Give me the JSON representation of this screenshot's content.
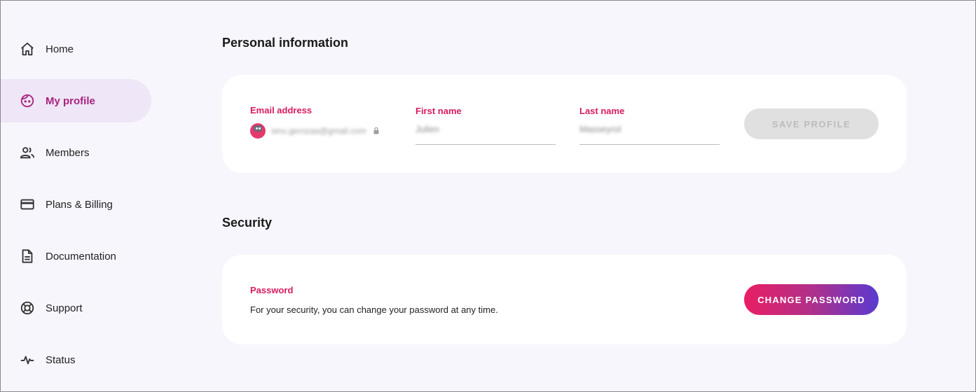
{
  "sidebar": {
    "items": [
      {
        "label": "Home",
        "icon": "home-icon"
      },
      {
        "label": "My profile",
        "icon": "face-icon",
        "active": true
      },
      {
        "label": "Members",
        "icon": "members-icon"
      },
      {
        "label": "Plans & Billing",
        "icon": "credit-card-icon"
      },
      {
        "label": "Documentation",
        "icon": "document-icon"
      },
      {
        "label": "Support",
        "icon": "lifebuoy-icon"
      },
      {
        "label": "Status",
        "icon": "activity-icon"
      }
    ]
  },
  "personal": {
    "title": "Personal information",
    "email_label": "Email address",
    "email_value": "sinu.gerozaa@gmail.com",
    "first_name_label": "First name",
    "first_name_value": "Julien",
    "last_name_label": "Last name",
    "last_name_value": "Masseyrol",
    "save_label": "SAVE PROFILE"
  },
  "security": {
    "title": "Security",
    "password_label": "Password",
    "password_desc": "For your security, you can change your password at any time.",
    "change_label": "CHANGE PASSWORD"
  },
  "colors": {
    "accent_pink": "#d81b60",
    "active_text": "#a8237e",
    "active_bg": "#efe6f7",
    "gradient_end": "#5a3ad0",
    "background": "#f7f6fd"
  }
}
